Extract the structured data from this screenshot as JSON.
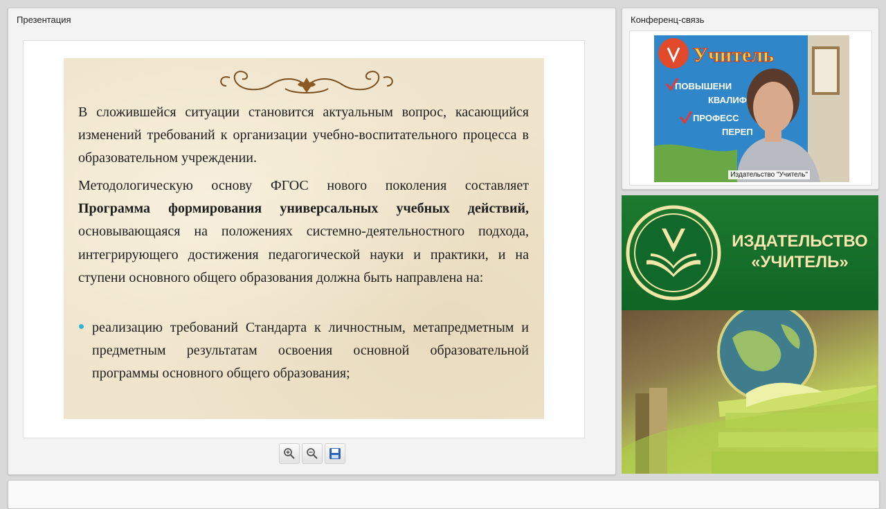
{
  "presentation": {
    "title": "Презентация",
    "slide": {
      "para1": "В сложившейся ситуации становится актуальным вопрос, касающийся изменений требований к организации учебно-воспитательного процесса в образовательном учреждении.",
      "para2_start": "Методологическую основу ФГОС нового поколения составляет ",
      "para2_bold": "Программа формирования универсальных учебных действий,",
      "para2_end": " основывающаяся на положениях системно-деятельностного подхода, интегрирующего достижения педагогической науки и практики, и на ступени основного общего образования должна быть направлена на:",
      "bullet1": "реализацию требований Стандарта к личностным, метапредметным и предметным результатам освоения основной образовательной программы основного общего образования;"
    },
    "toolbar": {
      "zoom_in_icon": "zoom-in-icon",
      "zoom_out_icon": "zoom-out-icon",
      "save_icon": "save-icon"
    }
  },
  "conference": {
    "title": "Конференц-связь",
    "caption": "Издательство \"Учитель\"",
    "banner": {
      "line1": "Учитель",
      "item1": "ПОВЫШЕНИ",
      "item2": "КВАЛИФ",
      "item3": "ПРОФЕСС",
      "item4": "ПЕРЕП"
    }
  },
  "brand": {
    "line1": "ИЗДАТЕЛЬСТВО",
    "line2": "«УЧИТЕЛЬ»"
  },
  "colors": {
    "brand_green": "#15702a",
    "brand_text": "#f6e7b0",
    "bullet": "#2fb4d6"
  }
}
